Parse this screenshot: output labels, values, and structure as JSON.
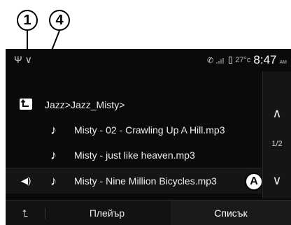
{
  "callouts": {
    "c1": "1",
    "c4": "4",
    "cA": "A"
  },
  "status_bar": {
    "left_icons": "Ψ ∨",
    "temperature": "27°c",
    "time": "8:47",
    "ampm": "AM"
  },
  "browser": {
    "folder_path": "Jazz>Jazz_Misty>",
    "tracks": [
      {
        "title": "Misty - 02 - Crawling Up A Hill.mp3",
        "playing": false
      },
      {
        "title": "Misty - just like heaven.mp3",
        "playing": false
      },
      {
        "title": "Misty - Nine Million Bicycles.mp3",
        "playing": true
      }
    ]
  },
  "scroll": {
    "page_indicator": "1/2"
  },
  "bottom_bar": {
    "player_tab": "Плейър",
    "list_tab": "Списък"
  },
  "colors": {
    "background": "#0a0a0a",
    "text": "#ffffff",
    "highlight_row": "#151515"
  }
}
